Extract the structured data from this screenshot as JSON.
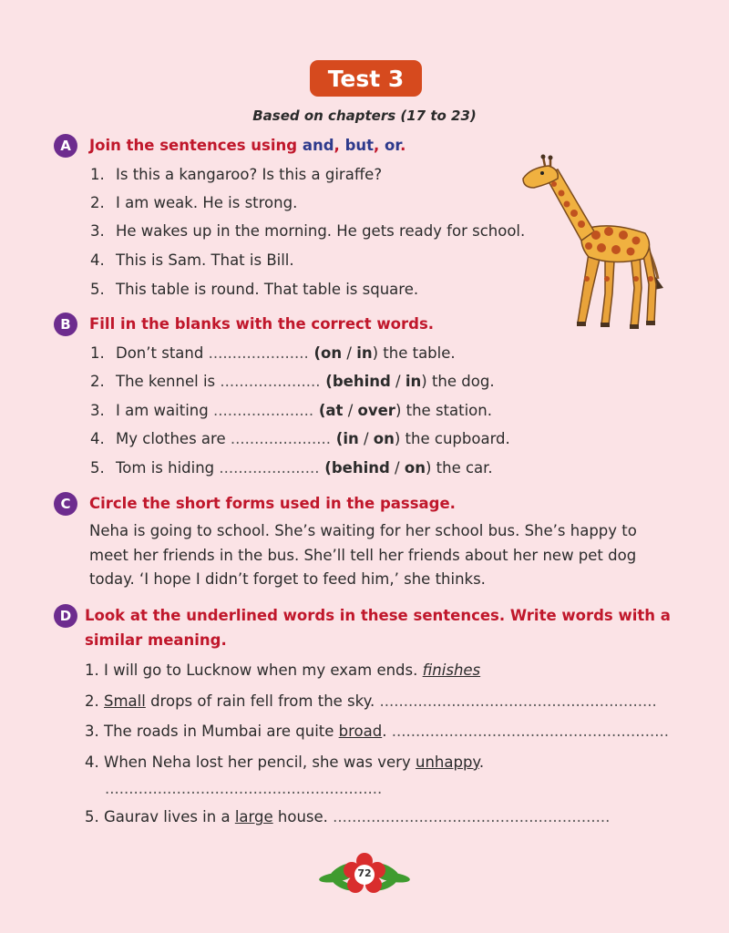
{
  "title": "Test 3",
  "subtitle": "Based on chapters (17 to 23)",
  "sectionA": {
    "badge": "A",
    "heading_prefix": "Join the sentences using ",
    "w_and": "and",
    "comma1": ", ",
    "w_but": "but",
    "comma2": ", ",
    "w_or": "or",
    "period": ".",
    "items": [
      {
        "num": "1.",
        "text": "Is this a kangaroo? Is this a giraffe?"
      },
      {
        "num": "2.",
        "text": "I am weak. He is strong."
      },
      {
        "num": "3.",
        "text": "He wakes up in the morning. He gets ready for school."
      },
      {
        "num": "4.",
        "text": "This is Sam. That is Bill."
      },
      {
        "num": "5.",
        "text": "This table is round. That table is square."
      }
    ]
  },
  "sectionB": {
    "badge": "B",
    "heading": "Fill in the blanks with the correct words.",
    "items": [
      {
        "num": "1.",
        "before": "Don’t stand ",
        "dots": ".....................",
        "open": " (",
        "opt1": "on",
        "slash": " / ",
        "opt2": "in",
        "close": ")",
        "after": " the table."
      },
      {
        "num": "2.",
        "before": "The kennel is ",
        "dots": ".....................",
        "open": " (",
        "opt1": "behind",
        "slash": " / ",
        "opt2": "in",
        "close": ")",
        "after": " the dog."
      },
      {
        "num": "3.",
        "before": "I am waiting ",
        "dots": ".....................",
        "open": " (",
        "opt1": "at",
        "slash": " / ",
        "opt2": "over",
        "close": ")",
        "after": " the station."
      },
      {
        "num": "4.",
        "before": "My clothes are ",
        "dots": ".....................",
        "open": " (",
        "opt1": "in",
        "slash": " / ",
        "opt2": "on",
        "close": ")",
        "after": " the cupboard."
      },
      {
        "num": "5.",
        "before": "Tom is hiding ",
        "dots": ".....................",
        "open": " (",
        "opt1": "behind",
        "slash": " / ",
        "opt2": "on",
        "close": ")",
        "after": " the car."
      }
    ]
  },
  "sectionC": {
    "badge": "C",
    "heading": "Circle the short forms used in the passage.",
    "lines": [
      "Neha is going to school. She’s waiting for her school bus. She’s happy to",
      "meet her friends in the bus. She’ll tell her friends about her new pet dog",
      "today. ‘I hope I didn’t forget to feed him,’ she thinks."
    ]
  },
  "sectionD": {
    "badge": "D",
    "heading_line1": "Look at the underlined words in these sentences. Write words with a",
    "heading_line2": "similar meaning.",
    "items": [
      {
        "num": "1.",
        "before": "I will go to Lucknow when my exam ",
        "under": "ends",
        "after": ". ",
        "answer": "finishes"
      },
      {
        "num": "2.",
        "before": "",
        "under": "Small",
        "after": " drops of rain fell from the sky. ",
        "dots": ".........................................................."
      },
      {
        "num": "3.",
        "before": "The roads in Mumbai are quite ",
        "under": "broad",
        "after": ". ",
        "dots": ".........................................................."
      },
      {
        "num": "4.",
        "before": "When Neha lost her pencil, she was very ",
        "under": "unhappy",
        "after": ".",
        "dots": ".........................................................."
      },
      {
        "num": "5.",
        "before": "Gaurav lives in a ",
        "under": "large",
        "after": " house. ",
        "dots": ".........................................................."
      }
    ]
  },
  "page_number": "72",
  "colors": {
    "background": "#fbe3e6",
    "title_box": "#d64a1e",
    "badge": "#6d2c8e",
    "heading_red": "#c0172b",
    "heading_blue": "#2e3a8c"
  },
  "icons": {
    "giraffe": "giraffe-illustration",
    "page_ornament": "flower-leaves-ornament"
  }
}
